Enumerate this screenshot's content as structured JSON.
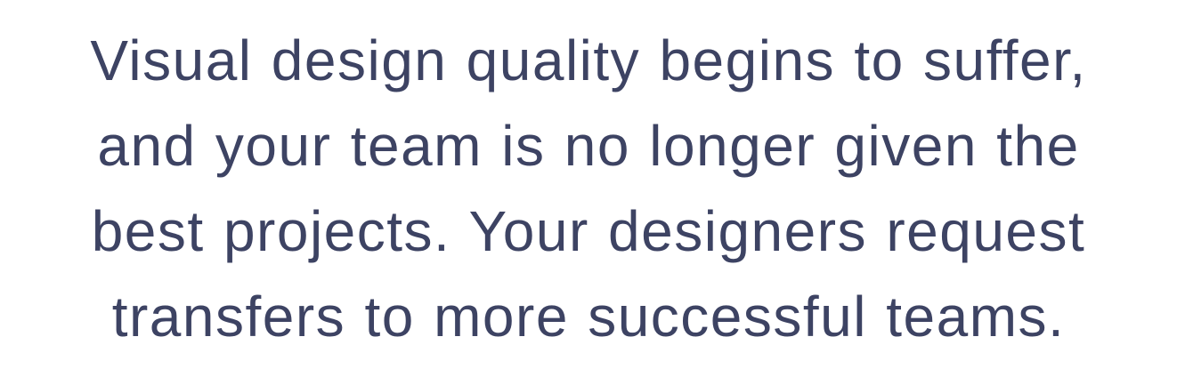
{
  "text": {
    "lines": [
      "Visual design quality begins to suffer,",
      "and your team is no longer given the",
      "best projects. Your designers request",
      "transfers to more successful teams."
    ]
  },
  "colors": {
    "text": "#3d4363",
    "background": "#ffffff"
  }
}
